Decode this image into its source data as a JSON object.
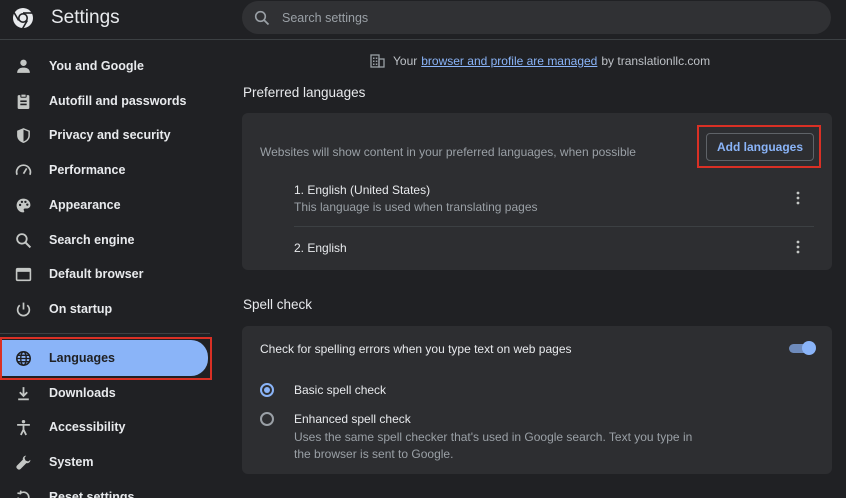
{
  "header": {
    "title": "Settings",
    "search_placeholder": "Search settings"
  },
  "sidebar": {
    "items": [
      {
        "label": "You and Google",
        "icon": "person-icon"
      },
      {
        "label": "Autofill and passwords",
        "icon": "clipboard-icon"
      },
      {
        "label": "Privacy and security",
        "icon": "shield-icon"
      },
      {
        "label": "Performance",
        "icon": "speedometer-icon"
      },
      {
        "label": "Appearance",
        "icon": "palette-icon"
      },
      {
        "label": "Search engine",
        "icon": "search-icon"
      },
      {
        "label": "Default browser",
        "icon": "browser-window-icon"
      },
      {
        "label": "On startup",
        "icon": "power-icon"
      },
      {
        "label": "Languages",
        "icon": "globe-icon",
        "active": true
      },
      {
        "label": "Downloads",
        "icon": "download-icon"
      },
      {
        "label": "Accessibility",
        "icon": "accessibility-icon"
      },
      {
        "label": "System",
        "icon": "wrench-icon"
      },
      {
        "label": "Reset settings",
        "icon": "reset-icon"
      }
    ]
  },
  "managed_notice": {
    "prefix": "Your",
    "link": "browser and profile are managed",
    "suffix": "by translationllc.com"
  },
  "preferred_languages": {
    "title": "Preferred languages",
    "description": "Websites will show content in your preferred languages, when possible",
    "add_button": "Add languages",
    "languages": [
      {
        "name": "1. English (United States)",
        "note": "This language is used when translating pages"
      },
      {
        "name": "2. English",
        "note": ""
      }
    ]
  },
  "spell_check": {
    "title": "Spell check",
    "toggle_label": "Check for spelling errors when you type text on web pages",
    "toggle_on": true,
    "options": [
      {
        "label": "Basic spell check",
        "selected": true,
        "note": ""
      },
      {
        "label": "Enhanced spell check",
        "selected": false,
        "note": "Uses the same spell checker that's used in Google search. Text you type in the browser is sent to Google."
      }
    ]
  },
  "colors": {
    "background": "#202124",
    "card": "#2d2e31",
    "accent": "#8ab4f8",
    "highlight": "#d93025"
  }
}
